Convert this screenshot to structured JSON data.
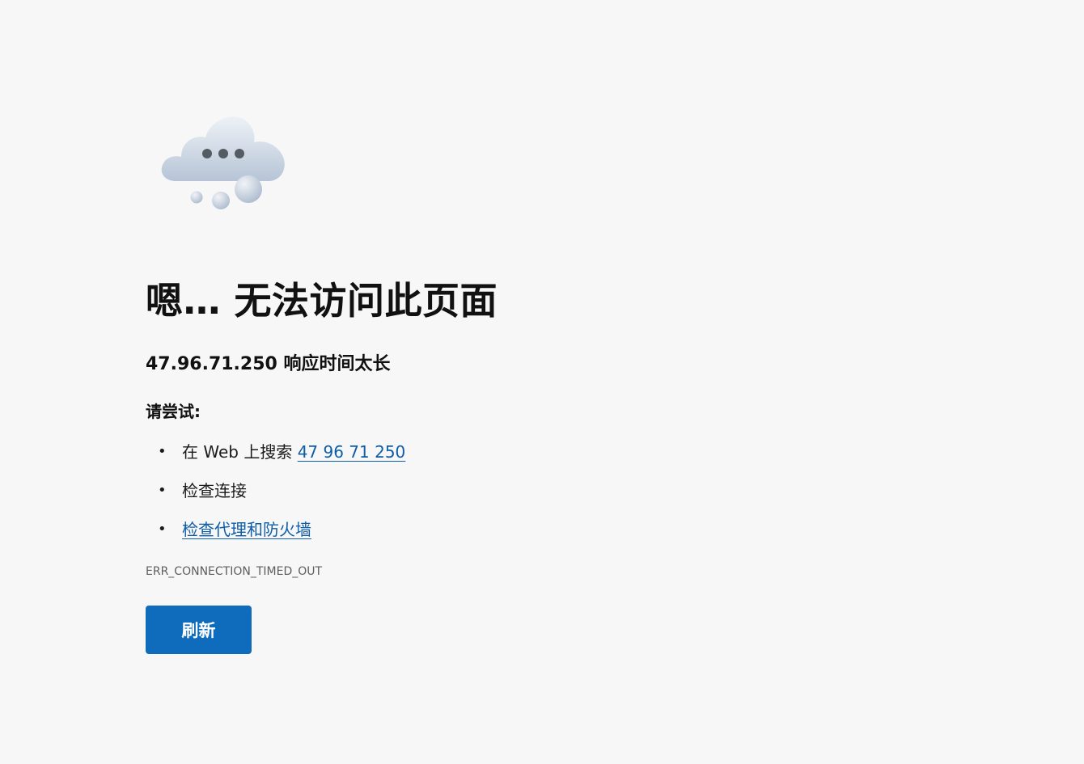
{
  "error": {
    "icon": "cloud-thinking-icon",
    "title": "嗯… 无法访问此页面",
    "subtitle": "47.96.71.250 响应时间太长",
    "try_label": "请尝试:",
    "suggestions": [
      {
        "prefix": "在 Web 上搜索 ",
        "link": "47 96 71 250"
      },
      {
        "text": "检查连接"
      },
      {
        "link": "检查代理和防火墙"
      }
    ],
    "code": "ERR_CONNECTION_TIMED_OUT",
    "refresh_label": "刷新"
  },
  "colors": {
    "background": "#f7f7f7",
    "link": "#0e5da8",
    "button": "#0f6cbd",
    "code_text": "#5e5e5e"
  }
}
